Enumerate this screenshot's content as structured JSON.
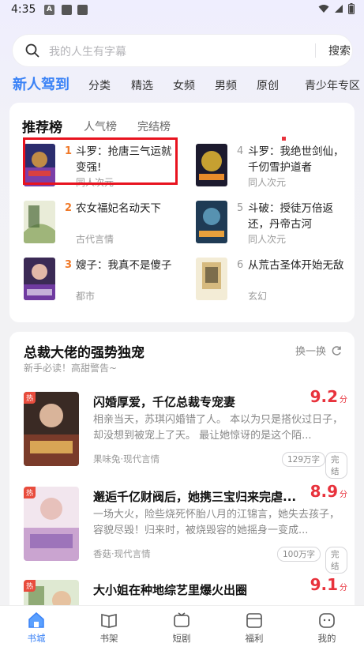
{
  "status": {
    "time": "4:35"
  },
  "search": {
    "placeholder": "我的人生有字幕",
    "button": "搜索"
  },
  "tabs": [
    "新人驾到",
    "分类",
    "精选",
    "女频",
    "男频",
    "原创",
    "青少年专区"
  ],
  "ranking": {
    "tabs": [
      "推荐榜",
      "人气榜",
      "完结榜"
    ],
    "items": [
      {
        "rank": "1",
        "title": "斗罗：抢唐三气运就变强!",
        "genre": "同人次元"
      },
      {
        "rank": "2",
        "title": "农女福妃名动天下",
        "genre": "古代言情"
      },
      {
        "rank": "3",
        "title": "嫂子：我真不是傻子",
        "genre": "都市"
      },
      {
        "rank": "4",
        "title": "斗罗：我绝世剑仙，千仞雪护道者",
        "genre": "同人次元"
      },
      {
        "rank": "5",
        "title": "斗破：授徒万倍返还，丹帝古河",
        "genre": "同人次元"
      },
      {
        "rank": "6",
        "title": "从荒古圣体开始无敌",
        "genre": "玄幻"
      }
    ]
  },
  "feed": {
    "title": "总裁大佬的强势独宠",
    "subtitle": "新手必读！高甜警告~",
    "refresh": "换一换",
    "books": [
      {
        "title": "闪婚厚爱，千亿总裁专宠妻",
        "score": "9.2",
        "unit": "分",
        "desc": "相亲当天，苏琪闪婚错了人。 本以为只是搭伙过日子，却没想到被宠上了天。 最让她惊讶的是这个陌...",
        "meta": "果味兔·现代言情",
        "words": "129万字",
        "status": "完结",
        "hot": "热"
      },
      {
        "title": "邂逅千亿财阀后，她携三宝归来完虐...",
        "score": "8.9",
        "unit": "分",
        "desc": "一场大火，险些烧死怀胎八月的江锦言，她失去孩子，容貌尽毁！归来时，被烧毁容的她摇身一变成...",
        "meta": "香菇·现代言情",
        "words": "100万字",
        "status": "完结",
        "hot": "热"
      },
      {
        "title": "大小姐在种地综艺里爆火出圈",
        "score": "9.1",
        "unit": "分",
        "desc": "",
        "meta": "",
        "words": "",
        "status": "",
        "hot": "热"
      }
    ]
  },
  "nav": [
    "书城",
    "书架",
    "短剧",
    "福利",
    "我的"
  ],
  "colors": {
    "accent": "#3a82f6",
    "score": "#e8323c",
    "rank_top": "#f07a2a"
  }
}
